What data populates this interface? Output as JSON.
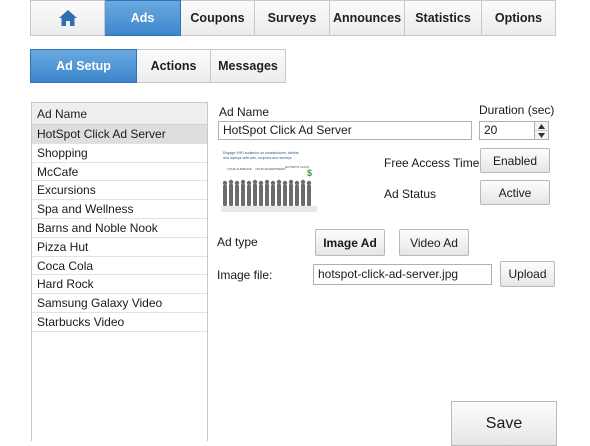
{
  "top_nav": {
    "home_icon": "home-icon",
    "tabs": [
      "Ads",
      "Coupons",
      "Surveys",
      "Announces",
      "Statistics",
      "Options"
    ],
    "active_tab": "Ads"
  },
  "sub_nav": {
    "tabs": [
      "Ad Setup",
      "Actions",
      "Messages"
    ],
    "active_tab": "Ad Setup"
  },
  "ad_list": {
    "header": "Ad Name",
    "items": [
      "HotSpot Click Ad Server",
      "Shopping",
      "McCafe",
      "Excursions",
      "Spa and Wellness",
      "Barns and Noble Nook",
      "Pizza Hut",
      "Coca Cola",
      "Hard Rock",
      "Samsung Galaxy Video",
      "Starbucks Video"
    ],
    "selected_index": 0
  },
  "form": {
    "ad_name_label": "Ad Name",
    "ad_name_value": "HotSpot Click Ad Server",
    "duration_label": "Duration (sec)",
    "duration_value": "20",
    "free_access_timer_label": "Free Access Timer",
    "free_access_timer_button": "Enabled",
    "ad_status_label": "Ad Status",
    "ad_status_button": "Active",
    "ad_type_label": "Ad type",
    "image_ad_button": "Image Ad",
    "video_ad_button": "Video Ad",
    "image_file_label": "Image file:",
    "image_file_value": "hotspot-click-ad-server.jpg",
    "upload_button": "Upload",
    "save_button": "Save"
  },
  "thumbnail": {
    "line1": "Engage WiFi audience on smartphones, tablets",
    "line2": "and laptops with ads, coupons and surveys",
    "labels": [
      "YOUR AUDIENCE",
      "YOUR ADVERTISERS",
      "HOTSPOT CLICK"
    ],
    "dollar": "$"
  },
  "colors": {
    "accent": "#3d86cc",
    "accent_border": "#2f74b8",
    "selected_row": "#dedede"
  }
}
